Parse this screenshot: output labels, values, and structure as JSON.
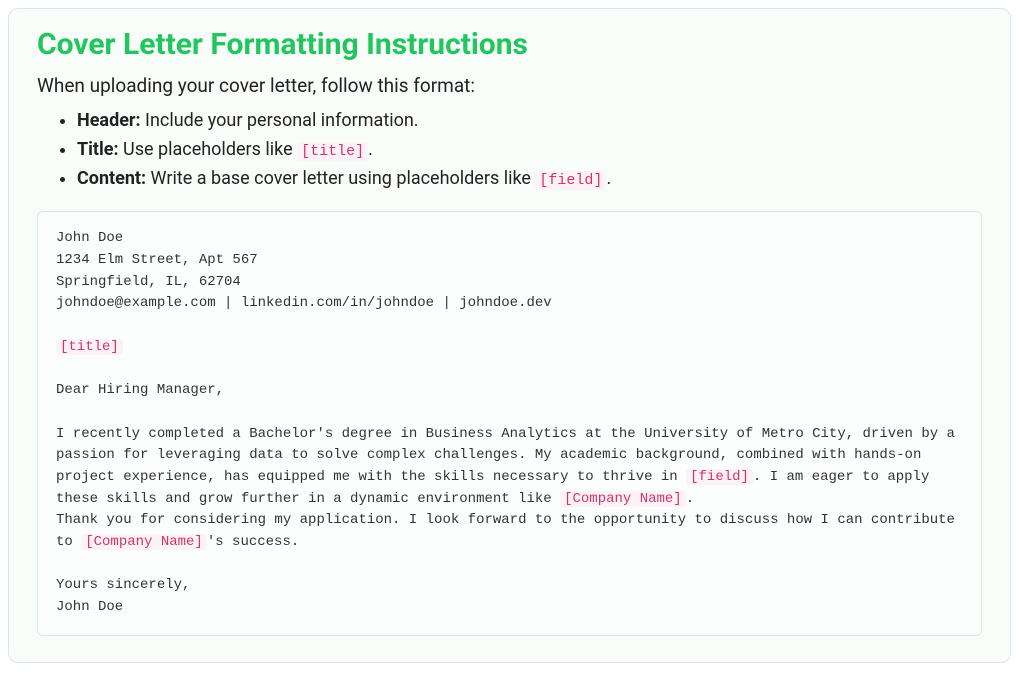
{
  "heading": "Cover Letter Formatting Instructions",
  "lead": "When uploading your cover letter, follow this format:",
  "rules": [
    {
      "label": "Header:",
      "text": " Include your personal information."
    },
    {
      "label": "Title:",
      "text": " Use placeholders like ",
      "placeholder": "[title]",
      "suffix": "."
    },
    {
      "label": "Content:",
      "text": " Write a base cover letter using placeholders like ",
      "placeholder": "[field]",
      "suffix": "."
    }
  ],
  "example": {
    "header": "John Doe\n1234 Elm Street, Apt 567\nSpringfield, IL, 62704\njohndoe@example.com | linkedin.com/in/johndoe | johndoe.dev",
    "title_placeholder": "[title]",
    "salutation": "Dear Hiring Manager,",
    "body1a": "I recently completed a Bachelor's degree in Business Analytics at the University of Metro City, driven by a passion for leveraging data to solve complex challenges. My academic background, combined with hands-on project experience, has equipped me with the skills necessary to thrive in ",
    "ph_field": "[field]",
    "body1b": ". I am eager to apply these skills and grow further in a dynamic environment like ",
    "ph_company1": "[Company Name]",
    "body1c": ".",
    "body2a": "Thank you for considering my application. I look forward to the opportunity to discuss how I can contribute to ",
    "ph_company2": "[Company Name]",
    "body2b": "'s success.",
    "closing": "Yours sincerely,\nJohn Doe"
  }
}
